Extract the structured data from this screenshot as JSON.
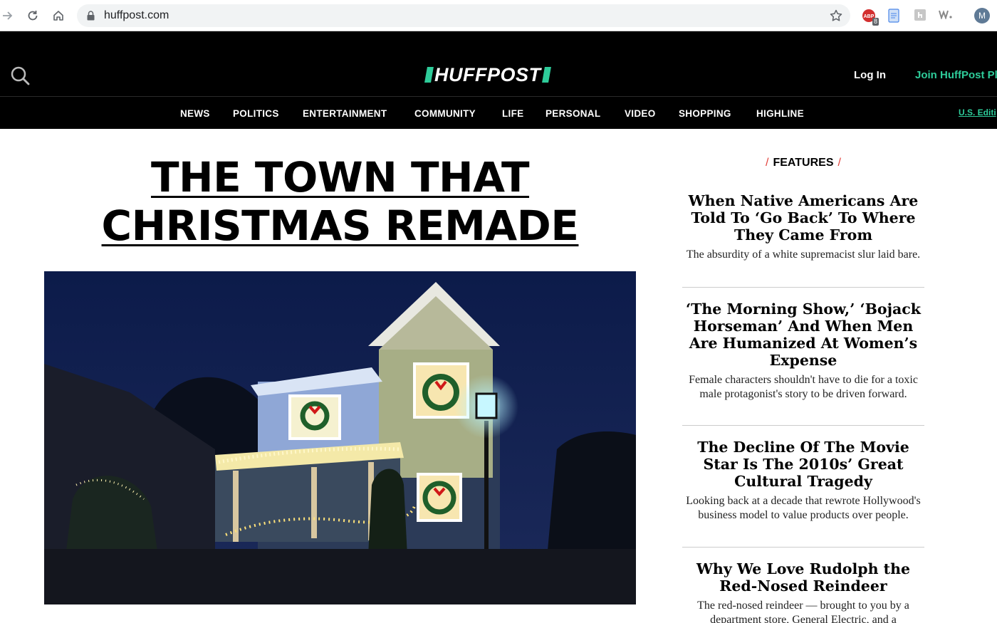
{
  "browser": {
    "url": "huffpost.com",
    "extension_badge": "8",
    "extension_abp": "ABP",
    "profile_initial": "M"
  },
  "site": {
    "logo": "HUFFPOST",
    "login": "Log In",
    "join": "Join HuffPost Pl",
    "edition": "U.S. Editi",
    "accent_color": "#2ecc9a",
    "nav": [
      "NEWS",
      "POLITICS",
      "ENTERTAINMENT",
      "COMMUNITY",
      "LIFE",
      "PERSONAL",
      "VIDEO",
      "SHOPPING",
      "HIGHLINE"
    ]
  },
  "main": {
    "headline_line1": "THE TOWN THAT",
    "headline_line2": "CHRISTMAS REMADE"
  },
  "sidebar": {
    "title": "FEATURES",
    "items": [
      {
        "title": "When Native Americans Are Told To ‘Go Back’ To Where They Came From",
        "desc": "The absurdity of a white supremacist slur laid bare."
      },
      {
        "title": "‘The Morning Show,’ ‘Bojack Horseman’ And When Men Are Humanized At Women’s Expense",
        "desc": "Female characters shouldn't have to die for a toxic male protagonist's story to be driven forward."
      },
      {
        "title": "The Decline Of The Movie Star Is The 2010s’ Great Cultural Tragedy",
        "desc": "Looking back at a decade that rewrote Hollywood's business model to value products over people."
      },
      {
        "title": "Why We Love Rudolph the Red-Nosed Reindeer",
        "desc": "The red-nosed reindeer — brought to you by a department store, General Electric, and a"
      }
    ]
  }
}
